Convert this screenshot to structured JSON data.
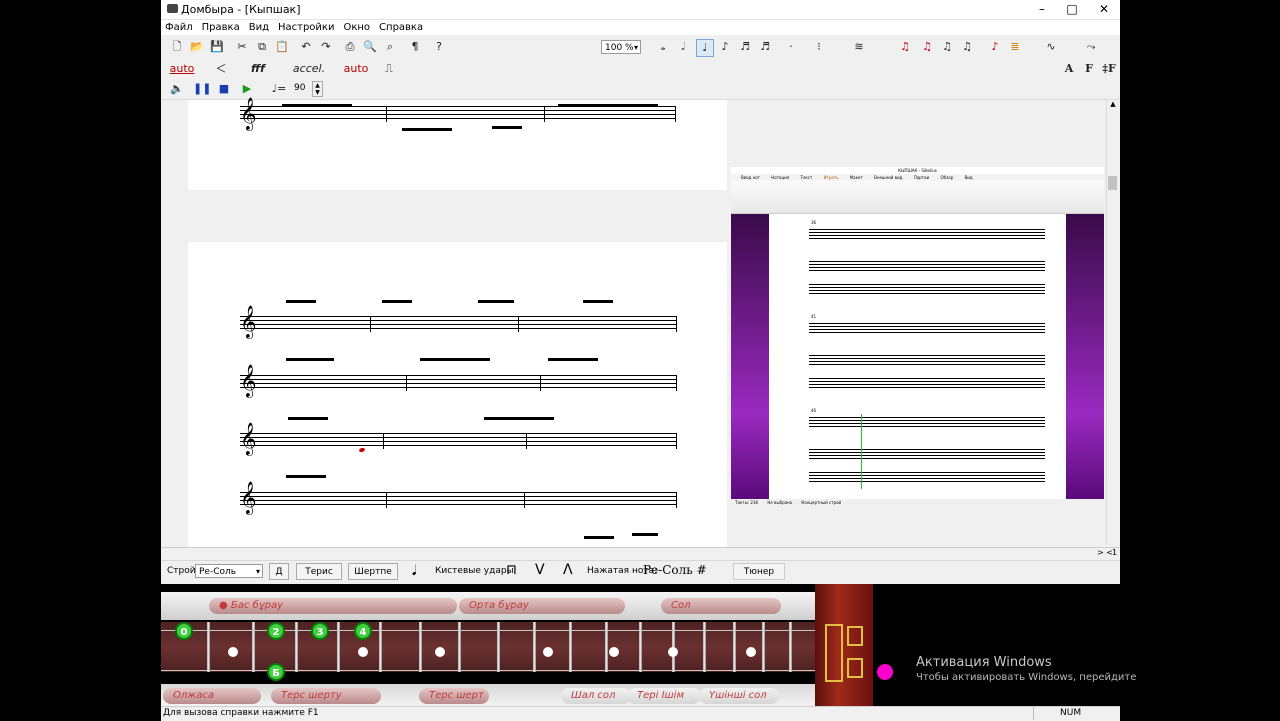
{
  "window": {
    "title": "Домбыра - [Кыпшак]",
    "minimize": "–",
    "maximize": "□",
    "close": "✕"
  },
  "menu": [
    "Файл",
    "Правка",
    "Вид",
    "Настройки",
    "Окно",
    "Справка"
  ],
  "toolbar1": {
    "zoom": "100 %"
  },
  "toolbar2": {
    "auto1": "auto",
    "dynamics": "fff",
    "accel": "accel.",
    "auto2": "auto",
    "font_a": "A",
    "font_f": "F",
    "font_ff": "‡F"
  },
  "toolbar3": {
    "tempo": "90"
  },
  "controls": {
    "tuning_label": "Строй:",
    "tuning_value": "Ре-Соль",
    "d_button": "Д",
    "reverse_bass": "Терис басу",
    "shertpe": "Шертпе",
    "strokes_label": "Кистевые удары:",
    "pressed_label": "Нажатая нота:",
    "pressed_value": "Ре-Соль #",
    "tuner": "Тюнер"
  },
  "split": {
    "nav": "> <",
    "page": "1"
  },
  "neck": {
    "top_buttons": [
      "Бас бұрау",
      "Орта бұрау",
      "Сол"
    ],
    "bottom_buttons": [
      "Олжаса",
      "Терс шерту",
      "Терс шерт",
      "Шал сол",
      "Тері Ішім",
      "Үшінші сол"
    ],
    "finger_labels": [
      "0",
      "2",
      "3",
      "4",
      "Б"
    ]
  },
  "status": {
    "help": "Для вызова справки нажмите F1",
    "num": "NUM"
  },
  "overlay": {
    "title": "КЫПШАК - Sibelius",
    "tabs": [
      "Ввод нот",
      "Нотация",
      "Текст",
      "Играть",
      "Макет",
      "Внешний вид",
      "Партии",
      "Обзор",
      "Вид"
    ],
    "status": [
      "Такты: 236",
      "Не выбрано",
      "Концертный строй"
    ],
    "bar_numbers": [
      "36",
      "41",
      "46"
    ]
  },
  "watermark": {
    "line1": "Активация Windows",
    "line2": "Чтобы активировать Windows, перейдите"
  }
}
